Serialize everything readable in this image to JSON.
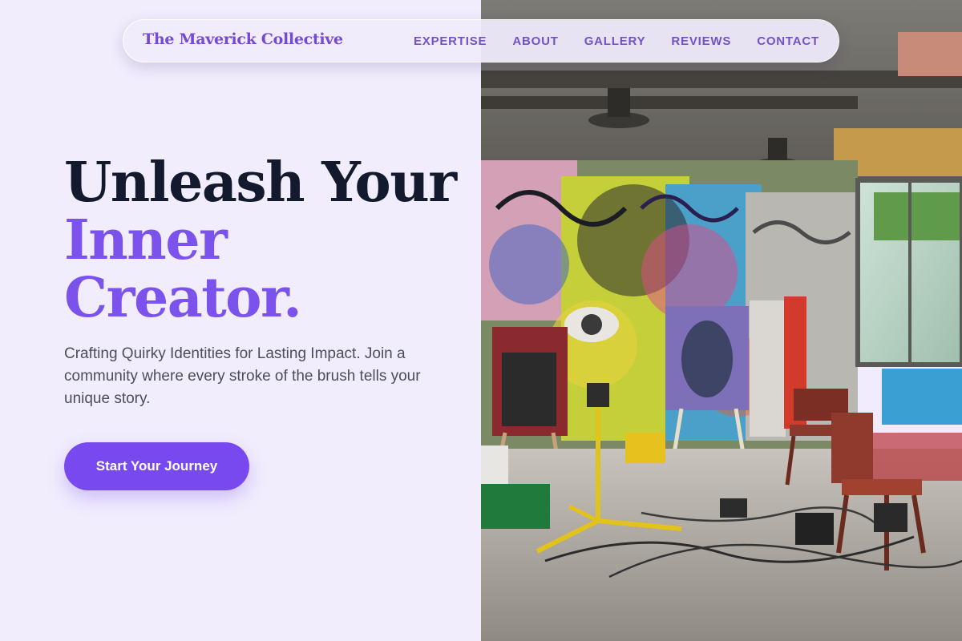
{
  "nav": {
    "brand": "The Maverick Collective",
    "links": [
      "EXPERTISE",
      "ABOUT",
      "GALLERY",
      "REVIEWS",
      "CONTACT"
    ]
  },
  "hero": {
    "headline_line1": "Unleash Your",
    "headline_line2": "Inner",
    "headline_line3": "Creator.",
    "subtitle": "Crafting Quirky Identities for Lasting Impact. Join a community where every stroke of the brush tells your unique story.",
    "cta_label": "Start Your Journey"
  },
  "colors": {
    "accent": "#7849ee",
    "brand_text": "#7548d6",
    "headline_dark": "#141a2e",
    "background": "#f1edfd"
  }
}
